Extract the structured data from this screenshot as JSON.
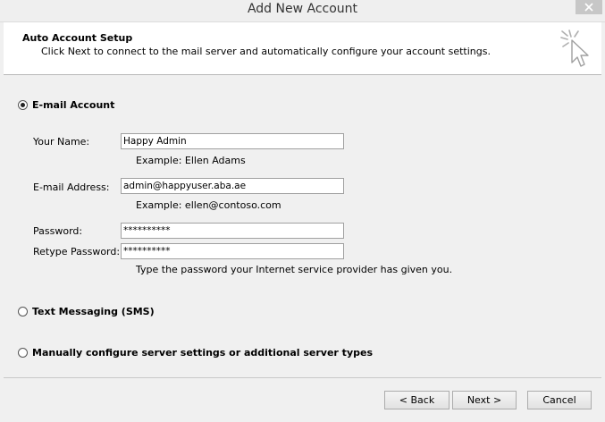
{
  "window": {
    "title": "Add New Account",
    "close_icon": "close-icon"
  },
  "header": {
    "title": "Auto Account Setup",
    "subtitle": "Click Next to connect to the mail server and automatically configure your account settings.",
    "icon": "cursor-click-icon"
  },
  "options": {
    "email_account": {
      "label": "E-mail Account",
      "selected": true
    },
    "sms": {
      "label": "Text Messaging (SMS)",
      "selected": false
    },
    "manual": {
      "label": "Manually configure server settings or additional server types",
      "selected": false
    }
  },
  "form": {
    "name_label": "Your Name:",
    "name_value": "Happy Admin",
    "name_example": "Example: Ellen Adams",
    "email_label": "E-mail Address:",
    "email_value": "admin@happyuser.aba.ae",
    "email_example": "Example: ellen@contoso.com",
    "password_label": "Password:",
    "password_value": "**********",
    "retype_label": "Retype Password:",
    "retype_value": "**********",
    "password_hint": "Type the password your Internet service provider has given you."
  },
  "buttons": {
    "back": "< Back",
    "next": "Next >",
    "cancel": "Cancel"
  }
}
